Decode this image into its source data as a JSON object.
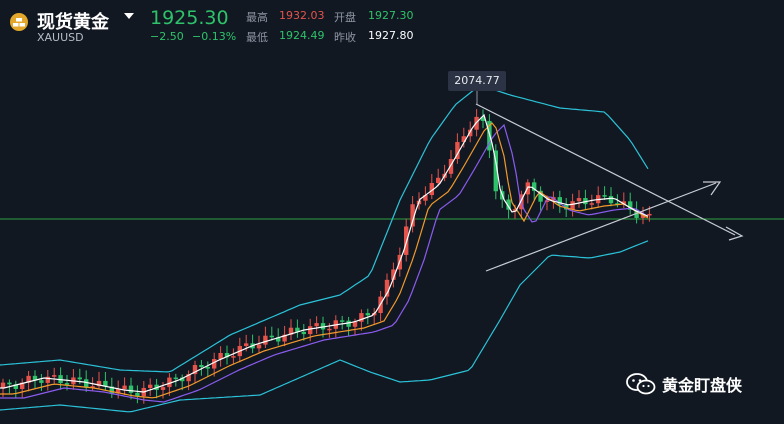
{
  "header": {
    "title": "现货黄金",
    "code": "XAUUSD",
    "price": "1925.30",
    "change": "−2.50",
    "change_pct": "−0.13%",
    "stats": {
      "high_label": "最高",
      "high_value": "1932.03",
      "open_label": "开盘",
      "open_value": "1927.30",
      "low_label": "最低",
      "low_value": "1924.49",
      "prev_close_label": "昨收",
      "prev_close_value": "1927.80"
    }
  },
  "chart": {
    "peak_label": "2074.77"
  },
  "watermark": {
    "text": "黄金盯盘侠"
  },
  "colors": {
    "background": "#121822",
    "up": "#e5534b",
    "down": "#2ec36a",
    "bollinger": "#2bc3d9",
    "ma_fast": "#ffffff",
    "ma_mid": "#f29a2b",
    "ma_slow": "#8a5cf0",
    "trendline": "#c8ccd4",
    "price_line": "#2ea043"
  },
  "icons": {
    "symbol_icon": "gold-bars-icon",
    "dropdown": "caret-down-icon",
    "watermark_icon": "wechat-icon"
  }
}
